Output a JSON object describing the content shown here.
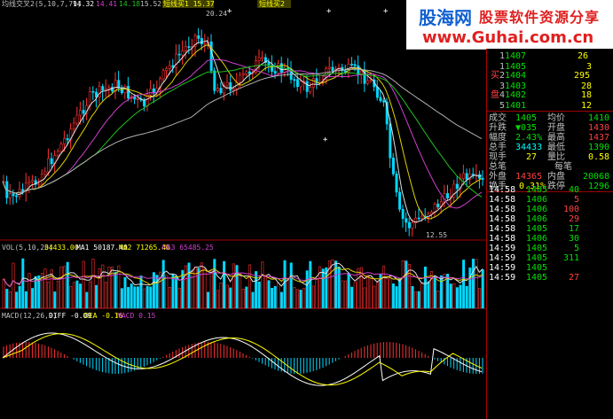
{
  "main": {
    "indicator_label": "均线交叉2(5,10,7,79)",
    "values": [
      "14.32",
      "14.41",
      "14.18",
      "15.52"
    ],
    "flag_label_1": "短线买1 15.37",
    "flag_label_2": "短线买2",
    "high_label": "20.24",
    "low_label": "12.55"
  },
  "vol": {
    "label": "VOL(5,10,20)",
    "v1": "34433.00",
    "ma1": "MA1 50187.40",
    "ma2": "MA2 71265.40",
    "ma3": "MA3 65485.25"
  },
  "macd": {
    "label": "MACD(12,26,9)",
    "diff": "DIFF -0.09",
    "dea": "DEA -0.16",
    "macd": "MACD 0.15"
  },
  "banner": {
    "logo": "股海网",
    "slogan": "股票软件资源分享",
    "url": "www.Guhai.com.cn"
  },
  "orderbook": {
    "side_buy": "买",
    "side_disk": "盘",
    "rows": [
      {
        "n": "1",
        "price": "1407",
        "vol": "26"
      },
      {
        "n": "1",
        "price": "1405",
        "vol": "3"
      },
      {
        "n": "2",
        "price": "1404",
        "vol": "295"
      },
      {
        "n": "3",
        "price": "1403",
        "vol": "28"
      },
      {
        "n": "4",
        "price": "1402",
        "vol": "18"
      },
      {
        "n": "5",
        "price": "1401",
        "vol": "12"
      }
    ]
  },
  "stats": [
    {
      "k1": "成交",
      "v1": "1405",
      "k2": "均价",
      "v2": "1410"
    },
    {
      "k1": "升跌",
      "v1": "▼035",
      "k2": "开盘",
      "v2": "1430"
    },
    {
      "k1": "幅度",
      "v1": "2.43%",
      "k2": "最高",
      "v2": "1437"
    },
    {
      "k1": "总手",
      "v1": "34433",
      "k2": "最低",
      "v2": "1390"
    },
    {
      "k1": "现手",
      "v1": "27",
      "k2": "量比",
      "v2": "0.58"
    },
    {
      "k1": "总笔",
      "v1": "",
      "k2": "每笔",
      "v2": ""
    },
    {
      "k1": "外盘",
      "v1": "14365",
      "k2": "内盘",
      "v2": "20068"
    },
    {
      "k1": "换手",
      "v1": "0.31%",
      "k2": "跌停",
      "v2": "1296"
    }
  ],
  "ticks": [
    {
      "time": "14:58",
      "price": "1405",
      "vol": "40",
      "c": "gn"
    },
    {
      "time": "14:58",
      "price": "1406",
      "vol": "5",
      "c": "rd"
    },
    {
      "time": "14:58",
      "price": "1406",
      "vol": "100",
      "c": "rd"
    },
    {
      "time": "14:58",
      "price": "1406",
      "vol": "29",
      "c": "rd"
    },
    {
      "time": "14:58",
      "price": "1405",
      "vol": "17",
      "c": "gn"
    },
    {
      "time": "14:58",
      "price": "1406",
      "vol": "30",
      "c": "gn"
    },
    {
      "time": "14:59",
      "price": "1405",
      "vol": "5",
      "c": "gn"
    },
    {
      "time": "14:59",
      "price": "1405",
      "vol": "311",
      "c": "gn"
    },
    {
      "time": "14:59",
      "price": "1405",
      "vol": "",
      "c": "gn"
    },
    {
      "time": "14:59",
      "price": "1405",
      "vol": "27",
      "c": "rd"
    }
  ],
  "colors": {
    "up": "#ff3030",
    "down": "#00d8ff",
    "ma_white": "#e0e0e0",
    "ma_yellow": "#e0d000",
    "ma_purple": "#d040d0",
    "ma_green": "#20c020",
    "border": "#a00000"
  }
}
